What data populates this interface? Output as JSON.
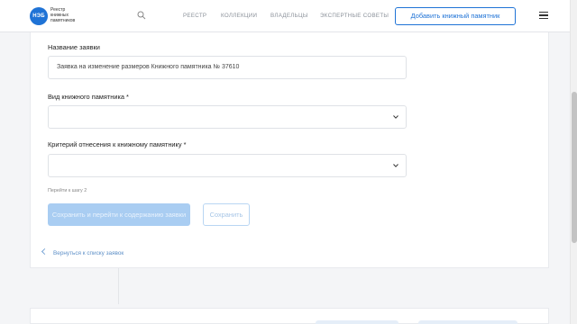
{
  "header": {
    "logo_text": "НЭБ",
    "brand_lines": [
      "Реестр",
      "книжных",
      "памятников"
    ],
    "nav": [
      "РЕЕСТР",
      "КОЛЛЕКЦИИ",
      "ВЛАДЕЛЬЦЫ",
      "ЭКСПЕРТНЫЕ СОВЕТЫ"
    ],
    "add_button": "Добавить книжный памятник"
  },
  "form": {
    "name_label": "Название заявки",
    "name_value": "Заявка на изменение размеров Книжного памятника № 37610",
    "type_label": "Вид книжного памятника *",
    "type_value": "",
    "criterion_label": "Критерий отнесения к книжному памятнику *",
    "criterion_value": "",
    "step_hint": "Перейти к шагу 2",
    "save_continue": "Сохранить и перейти к содержанию заявки",
    "save": "Сохранить"
  },
  "footer": {
    "back_link": "Вернуться к списку заявок"
  },
  "colors": {
    "accent": "#1f73d6",
    "disabled_primary": "#a9cdf2",
    "link": "#5d8fc7"
  }
}
